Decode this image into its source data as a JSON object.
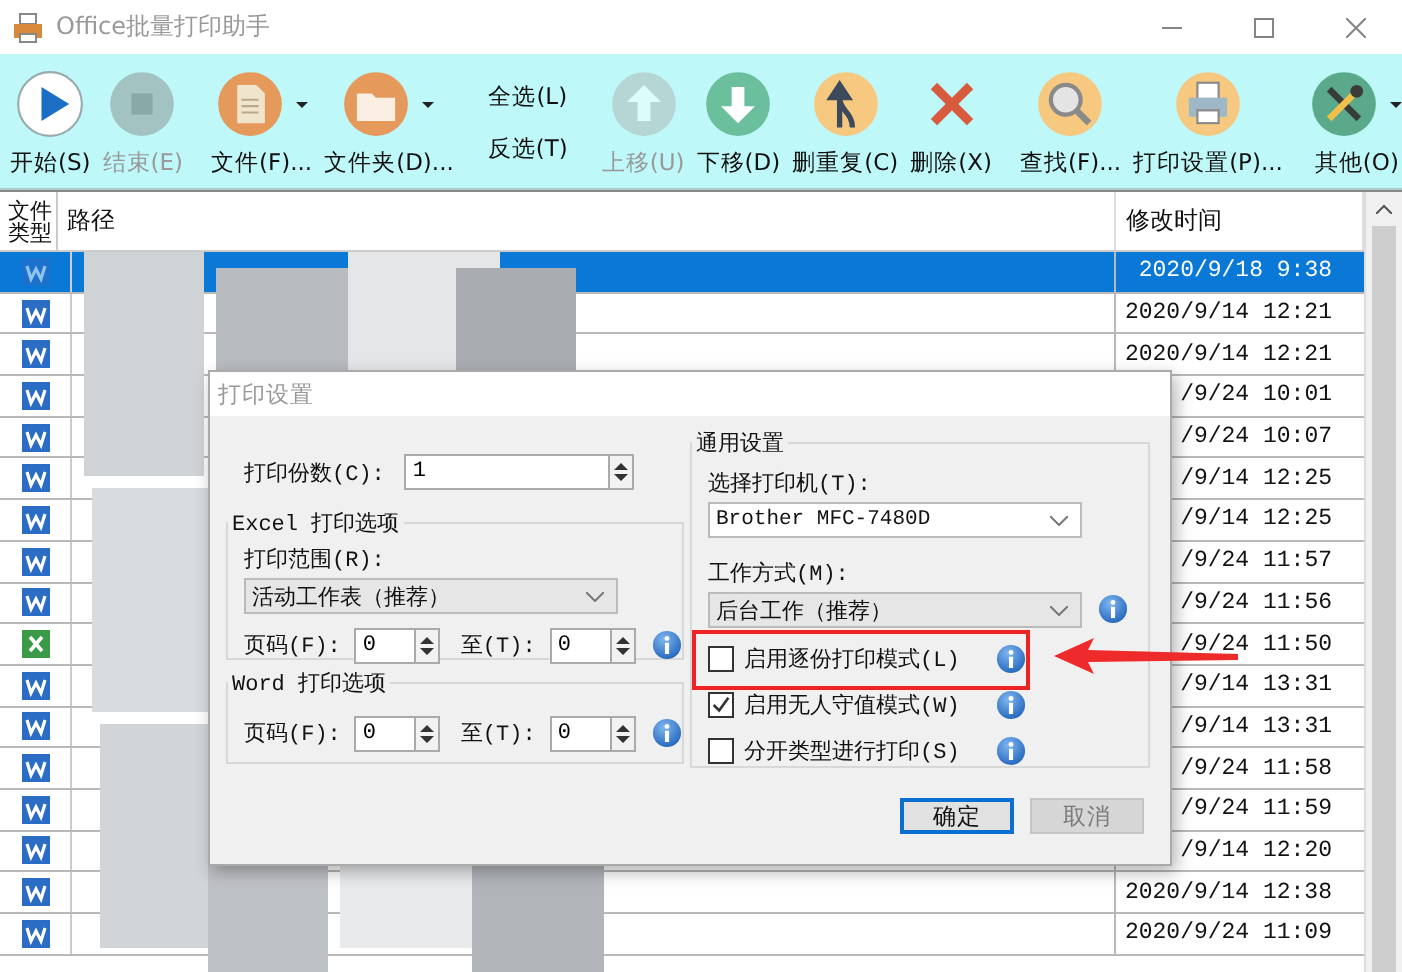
{
  "window": {
    "title": "Office批量打印助手"
  },
  "toolbar": {
    "groups": [
      [
        {
          "kind": "big",
          "label": "开始(S)",
          "disabled": false,
          "dropdown": false
        },
        {
          "kind": "big",
          "label": "结束(E)",
          "disabled": true,
          "dropdown": false
        }
      ],
      [
        {
          "kind": "big",
          "label": "文件(F)...",
          "disabled": false,
          "dropdown": true
        },
        {
          "kind": "big",
          "label": "文件夹(D)...",
          "disabled": false,
          "dropdown": true
        }
      ],
      [
        {
          "kind": "text",
          "label": "全选(L)",
          "disabled": false
        },
        {
          "kind": "text",
          "label": "反选(T)",
          "disabled": false
        }
      ],
      [
        {
          "kind": "big",
          "label": "上移(U)",
          "disabled": true,
          "dropdown": false
        },
        {
          "kind": "big",
          "label": "下移(D)",
          "disabled": false,
          "dropdown": false
        },
        {
          "kind": "big",
          "label": "删重复(C)",
          "disabled": false,
          "dropdown": false
        },
        {
          "kind": "big",
          "label": "删除(X)",
          "disabled": false,
          "dropdown": false
        }
      ],
      [
        {
          "kind": "big",
          "label": "查找(F)...",
          "disabled": false,
          "dropdown": false
        },
        {
          "kind": "big",
          "label": "打印设置(P)...",
          "disabled": false,
          "dropdown": false
        }
      ],
      [
        {
          "kind": "big",
          "label": "其他(O)",
          "disabled": false,
          "dropdown": true
        }
      ]
    ]
  },
  "table": {
    "columns": [
      "文件类型",
      "路径",
      "修改时间"
    ],
    "rows": [
      {
        "kind": "word",
        "selected": true,
        "modified": "2020/9/18 9:38"
      },
      {
        "kind": "word",
        "selected": false,
        "modified": "2020/9/14 12:21"
      },
      {
        "kind": "word",
        "selected": false,
        "modified": "2020/9/14 12:21"
      },
      {
        "kind": "word",
        "selected": false,
        "modified": "/9/24 10:01"
      },
      {
        "kind": "word",
        "selected": false,
        "modified": "/9/24 10:07"
      },
      {
        "kind": "word",
        "selected": false,
        "modified": "/9/14 12:25"
      },
      {
        "kind": "word",
        "selected": false,
        "modified": "/9/14 12:25"
      },
      {
        "kind": "word",
        "selected": false,
        "modified": "/9/24 11:57"
      },
      {
        "kind": "word",
        "selected": false,
        "modified": "/9/24 11:56"
      },
      {
        "kind": "excel",
        "selected": false,
        "modified": "/9/24 11:50"
      },
      {
        "kind": "word",
        "selected": false,
        "modified": "/9/14 13:31"
      },
      {
        "kind": "word",
        "selected": false,
        "modified": "/9/14 13:31"
      },
      {
        "kind": "word",
        "selected": false,
        "modified": "/9/24 11:58"
      },
      {
        "kind": "word",
        "selected": false,
        "modified": "/9/24 11:59"
      },
      {
        "kind": "word",
        "selected": false,
        "modified": "/9/14 12:20"
      },
      {
        "kind": "word",
        "selected": false,
        "modified": "2020/9/14 12:38"
      },
      {
        "kind": "word",
        "selected": false,
        "modified": "2020/9/24 11:09"
      }
    ]
  },
  "dialog": {
    "title": "打印设置",
    "copies": {
      "label": "打印份数(C):",
      "value": "1"
    },
    "excel_group": {
      "title": "Excel 打印选项",
      "range_label": "打印范围(R):",
      "range_value": "活动工作表（推荐）",
      "from": {
        "label": "页码(F):",
        "value": "0"
      },
      "to": {
        "label": "至(T):",
        "value": "0"
      }
    },
    "word_group": {
      "title": "Word 打印选项",
      "from": {
        "label": "页码(F):",
        "value": "0"
      },
      "to": {
        "label": "至(T):",
        "value": "0"
      }
    },
    "general_group": {
      "title": "通用设置",
      "printer_label": "选择打印机(T):",
      "printer_value": "Brother MFC-7480D",
      "mode_label": "工作方式(M):",
      "mode_value": "后台工作（推荐）",
      "options": [
        {
          "label": "启用逐份打印模式(L)",
          "checked": false,
          "highlighted": true
        },
        {
          "label": "启用无人守值模式(W)",
          "checked": true,
          "highlighted": false
        },
        {
          "label": "分开类型进行打印(S)",
          "checked": false,
          "highlighted": false
        }
      ]
    },
    "buttons": [
      {
        "label": "确定",
        "default": true,
        "disabled": false
      },
      {
        "label": "取消",
        "default": false,
        "disabled": true
      }
    ]
  }
}
